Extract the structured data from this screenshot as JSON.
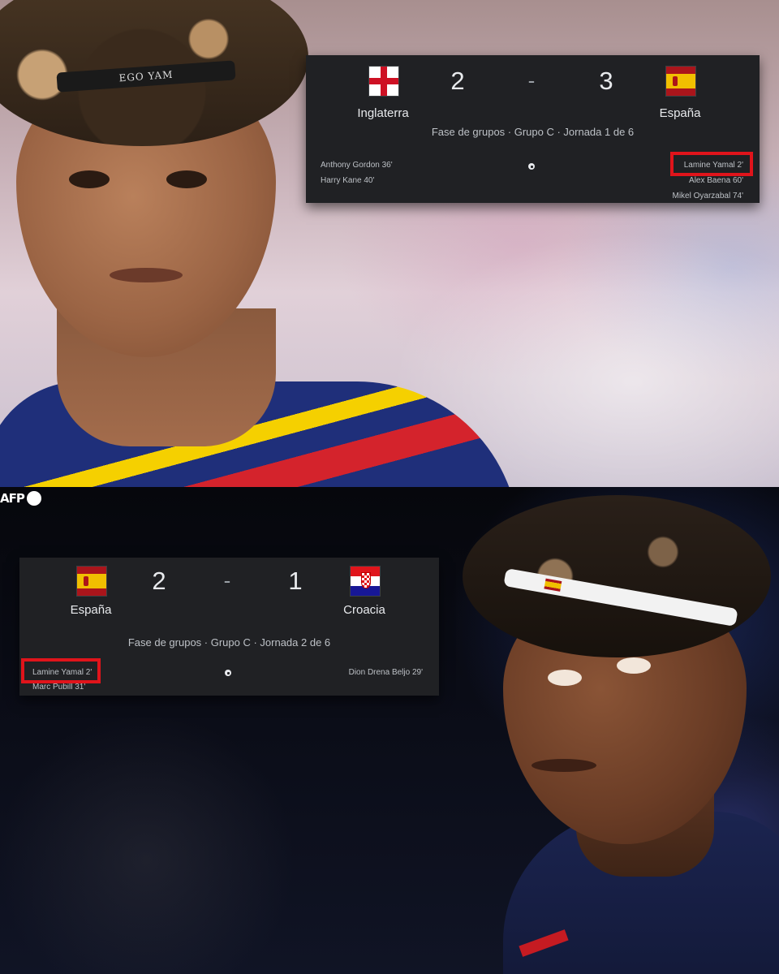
{
  "photo_credit": "AFP",
  "headband_text": "EGO YAM",
  "matches": [
    {
      "home": {
        "name": "Inglaterra",
        "flag": "england-flag"
      },
      "away": {
        "name": "España",
        "flag": "spain-flag"
      },
      "home_score": "2",
      "away_score": "3",
      "separator": "-",
      "stage": "Fase de grupos · Grupo C · Jornada 1 de 6",
      "home_scorers": [
        "Anthony Gordon 36'",
        "Harry Kane 40'"
      ],
      "away_scorers": [
        "Lamine Yamal 2'",
        "Alex Baena 60'",
        "Mikel Oyarzabal 74'"
      ]
    },
    {
      "home": {
        "name": "España",
        "flag": "spain-flag"
      },
      "away": {
        "name": "Croacia",
        "flag": "croatia-flag"
      },
      "home_score": "2",
      "away_score": "1",
      "separator": "-",
      "stage": "Fase de grupos · Grupo C · Jornada 2 de 6",
      "home_scorers": [
        "Lamine Yamal 2'",
        "Marc Pubill 31'"
      ],
      "away_scorers": [
        "Dion Drena Beljo 29'"
      ]
    }
  ],
  "highlight_color": "#e0141b"
}
